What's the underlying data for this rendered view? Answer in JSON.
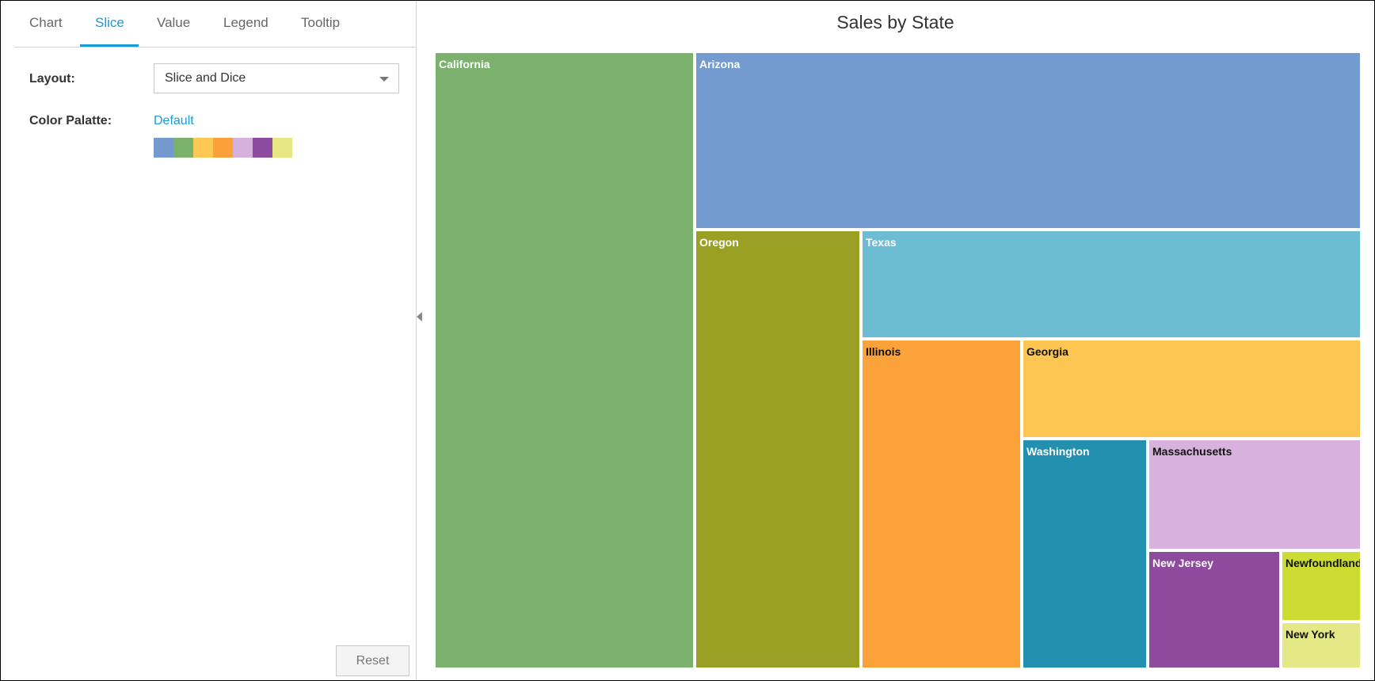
{
  "tabs": [
    {
      "label": "Chart",
      "active": false
    },
    {
      "label": "Slice",
      "active": true
    },
    {
      "label": "Value",
      "active": false
    },
    {
      "label": "Legend",
      "active": false
    },
    {
      "label": "Tooltip",
      "active": false
    }
  ],
  "settings": {
    "layout_label": "Layout:",
    "layout_value": "Slice and Dice",
    "palette_label": "Color Palatte:",
    "palette_name": "Default",
    "palette_colors": [
      "#7399ce",
      "#7ab26b",
      "#fdc853",
      "#fca03c",
      "#d7b1de",
      "#8c4b9e",
      "#e7e884"
    ]
  },
  "reset_label": "Reset",
  "chart_data": {
    "type": "treemap",
    "title": "Sales by State",
    "layout": "Slice and Dice",
    "items": [
      {
        "label": "California",
        "color": "#7bb16c",
        "text_color": "#ffffff"
      },
      {
        "label": "Arizona",
        "color": "#739bcf",
        "text_color": "#ffffff"
      },
      {
        "label": "Oregon",
        "color": "#9aa024",
        "text_color": "#ffffff"
      },
      {
        "label": "Texas",
        "color": "#6cbcd4",
        "text_color": "#ffffff"
      },
      {
        "label": "Illinois",
        "color": "#fca23b",
        "text_color": "#111111"
      },
      {
        "label": "Georgia",
        "color": "#fdc653",
        "text_color": "#111111"
      },
      {
        "label": "Washington",
        "color": "#2490b0",
        "text_color": "#ffffff"
      },
      {
        "label": "Massachusetts",
        "color": "#d8b1de",
        "text_color": "#111111"
      },
      {
        "label": "New Jersey",
        "color": "#8e4a9d",
        "text_color": "#ffffff"
      },
      {
        "label": "Newfoundland",
        "color": "#ccdc33",
        "text_color": "#111111"
      },
      {
        "label": "New York",
        "color": "#e4e887",
        "text_color": "#111111"
      }
    ]
  }
}
